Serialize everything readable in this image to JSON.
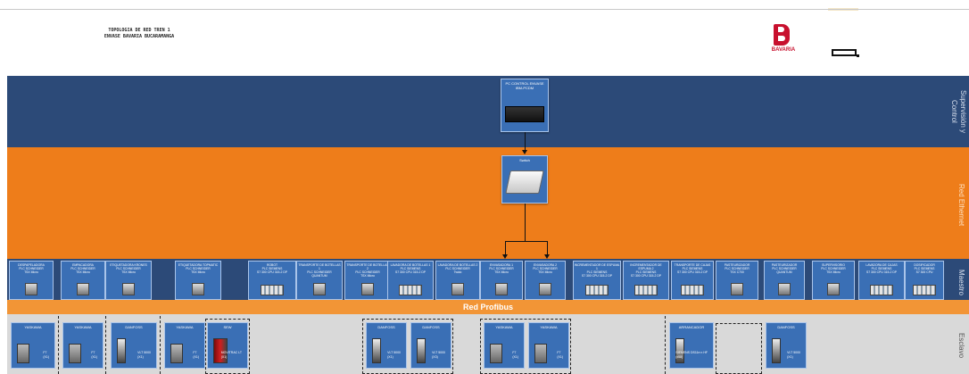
{
  "title": {
    "line1": "TOPOLOGIA DE RED TREN 1",
    "line2": "ENVASE BAVARIA BUCARAMANGA"
  },
  "brand": {
    "name": "BAVARIA",
    "color": "#c8102e"
  },
  "bands": {
    "supervision": "Supervisión y Control",
    "ethernet": "Red Ethernet",
    "maestro": "Maestro",
    "profibus": "Red Profibus",
    "esclavo": "Esclavo"
  },
  "pc": {
    "title": "PC CONTROL ENVASE",
    "model": "IBM-PCDM"
  },
  "switch": {
    "title": "Switch"
  },
  "masters": [
    {
      "name": "DESPAPELADORA",
      "plc": "PLC SCHNEIDER",
      "model": "TSX Micro"
    },
    {
      "name": "EMPACADORA",
      "plc": "PLC SCHNEIDER",
      "model": "TSX Micro"
    },
    {
      "name": "ETIQUETADORA KRONES",
      "plc": "PLC SCHNEIDER",
      "model": "TSX Micro"
    },
    {
      "name": "ETIQUETADORA TOPMATIC",
      "plc": "PLC SCHNEIDER",
      "model": "TSX Micro"
    },
    {
      "name": "ROBOT",
      "plc": "PLC SIEMENS",
      "model": "S7 300 CPU 315-2 DP"
    },
    {
      "name": "TRANSPORTE DE BOTELLAS 1",
      "plc": "PLC SCHNEIDER",
      "model": "QUANTUM"
    },
    {
      "name": "TRANSPORTE DE BOTELLAS 2",
      "plc": "PLC SCHNEIDER",
      "model": "TSX Micro"
    },
    {
      "name": "LAVADORA DE BOTELLAS 1",
      "plc": "PLC SIEMENS",
      "model": "S7 300 CPU 315-2 DP"
    },
    {
      "name": "LAVADORA DE BOTELLAS 2",
      "plc": "PLC SCHNEIDER",
      "model": "Twido"
    },
    {
      "name": "ENVASADORA 1",
      "plc": "PLC SCHNEIDER",
      "model": "TSX Micro"
    },
    {
      "name": "ENVASADORA 2",
      "plc": "PLC SCHNEIDER",
      "model": "TSX Micro"
    },
    {
      "name": "INCREMENTADOR DE ESPUMA 1",
      "plc": "PLC SIEMENS",
      "model": "S7 300 CPU 315-2 DP"
    },
    {
      "name": "INCREMENTADOR DE ESPUMA 2",
      "plc": "PLC SIEMENS",
      "model": "S7 300 CPU 315-2 DP"
    },
    {
      "name": "TRANSPORTE DE CAJAS",
      "plc": "PLC SIEMENS",
      "model": "S7 300 CPU 315-2 DP"
    },
    {
      "name": "PASTEURIZADOR",
      "plc": "PLC SCHNEIDER",
      "model": "TSX C700"
    },
    {
      "name": "PASTEURIZADOR",
      "plc": "PLC SCHNEIDER",
      "model": "QUANTUM"
    },
    {
      "name": "SUPERVISORIO",
      "plc": "PLC SCHNEIDER",
      "model": "TSX Micro"
    },
    {
      "name": "LAVADORA DE CAJAS",
      "plc": "PLC SIEMENS",
      "model": "S7 300 CPU 315-2 DP"
    },
    {
      "name": "DOSIFICADOR",
      "plc": "PLC SIEMENS",
      "model": "S7 300 CPU"
    }
  ],
  "slaves": [
    {
      "brand": "YASKAWA",
      "model": "F7",
      "qty": "(X1)"
    },
    {
      "brand": "YASKAWA",
      "model": "F7",
      "qty": "(X1)"
    },
    {
      "brand": "DANFOSS",
      "model": "VLT 5000",
      "qty": "(X1)"
    },
    {
      "brand": "YASKAWA",
      "model": "F7",
      "qty": "(X1)"
    },
    {
      "brand": "SEW",
      "model": "MOVITRAC LT",
      "qty": "(X1)"
    },
    {
      "brand": "DANFOSS",
      "model": "VLT 5000",
      "qty": "(X1)"
    },
    {
      "brand": "DANFOSS",
      "model": "VLT 5000",
      "qty": "(X3)"
    },
    {
      "brand": "YASKAWA",
      "model": "F7",
      "qty": "(X1)"
    },
    {
      "brand": "YASKAWA",
      "model": "F7",
      "qty": "(X1)"
    },
    {
      "brand": "ARRANCADOR",
      "model": "SIEMENS DS11e n HF",
      "qty": "(x58)"
    },
    {
      "brand": "DANFOSS",
      "model": "VLT 5000",
      "qty": "(X1)"
    }
  ]
}
